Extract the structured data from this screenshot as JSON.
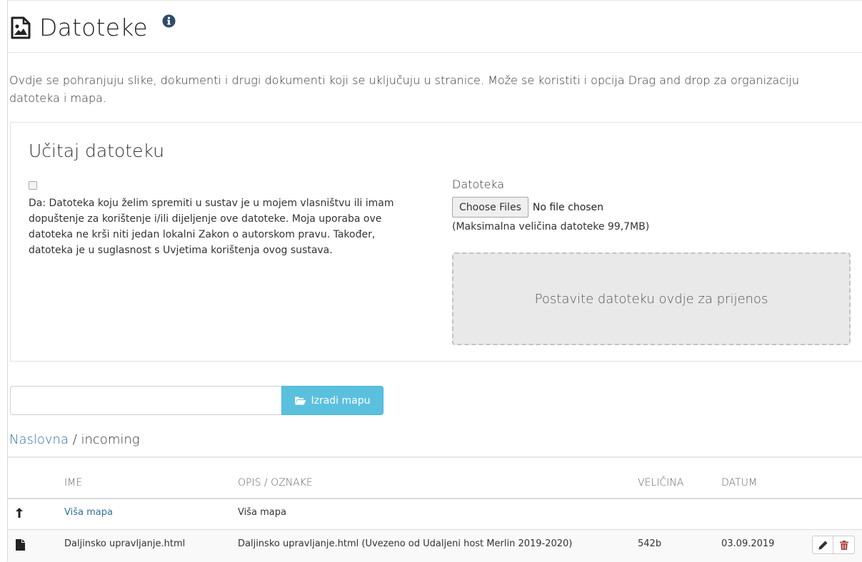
{
  "header": {
    "title": "Datoteke",
    "description": "Ovdje se pohranjuju slike, dokumenti i drugi dokumenti koji se uključuju u stranice. Može se koristiti i opcija Drag and drop za organizaciju datoteka i mapa."
  },
  "upload": {
    "title": "Učitaj datoteku",
    "consent_text": "Da: Datoteka koju želim spremiti u sustav je u mojem vlasništvu ili imam dopuštenje za korištenje i/ili dijeljenje ove datoteke. Moja uporaba ove datoteka ne krši niti jedan lokalni Zakon o autorskom pravu. Također, datoteka je u suglasnost s Uvjetima korištenja ovog sustava.",
    "file_label": "Datoteka",
    "choose_button": "Choose Files",
    "no_file": "No file chosen",
    "max_size": "(Maksimalna veličina datoteke 99,7MB)",
    "dropzone_text": "Postavite datoteku ovdje za prijenos"
  },
  "folder": {
    "input_value": "",
    "create_button": "Izradi mapu"
  },
  "breadcrumb": {
    "root": "Naslovna",
    "separator": " / ",
    "current": "incoming"
  },
  "table": {
    "headers": {
      "name": "IME",
      "description": "OPIS / OZNAKE",
      "size": "VELIČINA",
      "date": "DATUM"
    },
    "rows": [
      {
        "icon": "level-up-icon",
        "name": "Viša mapa",
        "description": "Viša mapa",
        "size": "",
        "date": ""
      },
      {
        "icon": "file-icon",
        "name": "Daljinsko upravljanje.html",
        "description": "Daljinsko upravljanje.html (Uvezeno od Udaljeni host Merlin 2019-2020)",
        "size": "542b",
        "date": "03.09.2019"
      }
    ]
  },
  "colors": {
    "accent": "#5bc0de",
    "link": "#31709c",
    "delete": "#a94442"
  }
}
